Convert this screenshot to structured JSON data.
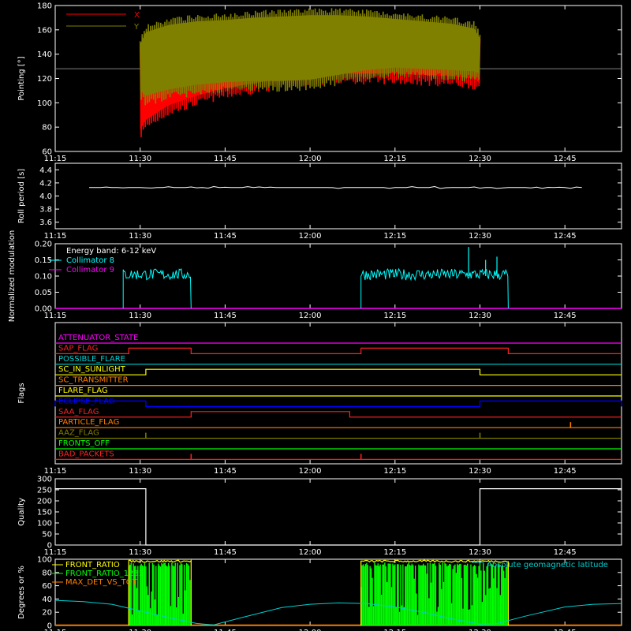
{
  "chart_data": [
    {
      "type": "area",
      "panel": "pointing",
      "ylabel": "Pointing [°]",
      "ylim": [
        60,
        180
      ],
      "yticks": [
        60,
        80,
        100,
        120,
        140,
        160,
        180
      ],
      "xlim": [
        "11:15",
        "12:55"
      ],
      "xticks": [
        "11:15",
        "11:30",
        "11:45",
        "12:00",
        "12:15",
        "12:30",
        "12:45"
      ],
      "reference_line": 128,
      "legend_position": "top-left",
      "series": [
        {
          "name": "X",
          "color": "#ff0000",
          "x": [
            "11:30",
            "11:31",
            "11:35",
            "11:40",
            "11:45",
            "11:50",
            "11:55",
            "12:00",
            "12:05",
            "12:10",
            "12:15",
            "12:20",
            "12:25",
            "12:29",
            "12:30"
          ],
          "upper": [
            148,
            150,
            154,
            157,
            159,
            160,
            161,
            161,
            160,
            160,
            158,
            157,
            156,
            153,
            152
          ],
          "lower": [
            72,
            80,
            92,
            100,
            106,
            110,
            114,
            117,
            118,
            118,
            118,
            117,
            116,
            114,
            110
          ]
        },
        {
          "name": "Y",
          "color": "#808000",
          "x": [
            "11:30",
            "11:31",
            "11:35",
            "11:40",
            "11:45",
            "11:50",
            "11:55",
            "12:00",
            "12:05",
            "12:10",
            "12:15",
            "12:20",
            "12:25",
            "12:29",
            "12:30"
          ],
          "upper": [
            152,
            162,
            168,
            171,
            172,
            174,
            175,
            176,
            176,
            175,
            173,
            171,
            169,
            165,
            157
          ],
          "lower": [
            104,
            100,
            105,
            109,
            111,
            112,
            112,
            113,
            117,
            121,
            123,
            122,
            121,
            120,
            118
          ]
        }
      ]
    },
    {
      "type": "line",
      "panel": "roll-period",
      "ylabel": "Roll period [s]",
      "ylim": [
        3.5,
        4.5
      ],
      "yticks": [
        3.6,
        3.8,
        4.0,
        4.2,
        4.4
      ],
      "xlim": [
        "11:15",
        "12:55"
      ],
      "xticks": [
        "11:15",
        "11:30",
        "11:45",
        "12:00",
        "12:15",
        "12:30",
        "12:45"
      ],
      "series": [
        {
          "name": "",
          "color": "#ffffff",
          "x": [
            "11:15",
            "12:55"
          ],
          "y": [
            4.13,
            4.13
          ]
        }
      ]
    },
    {
      "type": "line",
      "panel": "modulation",
      "ylabel": "Normalized modulation",
      "ylim": [
        0.0,
        0.2
      ],
      "yticks": [
        0.0,
        0.05,
        0.1,
        0.15,
        0.2
      ],
      "xlim": [
        "11:15",
        "12:55"
      ],
      "xticks": [
        "11:15",
        "11:30",
        "11:45",
        "12:00",
        "12:15",
        "12:30",
        "12:45"
      ],
      "annotation": "Energy band: 6-12 keV",
      "series": [
        {
          "name": "Collimator 8",
          "color": "#00ffff",
          "segments": [
            {
              "start": "11:27",
              "end": "11:39",
              "mean": 0.105
            },
            {
              "start": "12:09",
              "end": "12:35",
              "mean": 0.105
            }
          ],
          "peaks": [
            {
              "x": "12:28",
              "y": 0.19
            },
            {
              "x": "12:33",
              "y": 0.16
            },
            {
              "x": "12:31",
              "y": 0.15
            }
          ]
        },
        {
          "name": "Collimator 9",
          "color": "#ff00ff",
          "x": [
            "11:15",
            "12:55"
          ],
          "y": [
            0.0,
            0.0
          ]
        }
      ]
    },
    {
      "type": "line",
      "panel": "flags",
      "ylabel": "Flags",
      "xlim": [
        "11:15",
        "12:55"
      ],
      "xticks": [
        "11:15",
        "11:30",
        "11:45",
        "12:00",
        "12:15",
        "12:30",
        "12:45"
      ],
      "series": [
        {
          "name": "ATTENUATOR_STATE",
          "color": "#ff00ff",
          "steps": []
        },
        {
          "name": "SAP_FLAG",
          "color": "#ff2020",
          "steps": [
            [
              "11:28",
              "11:39"
            ],
            [
              "12:09",
              "12:35"
            ]
          ]
        },
        {
          "name": "POSSIBLE_FLARE",
          "color": "#00d0d0",
          "steps": []
        },
        {
          "name": "SC_IN_SUNLIGHT",
          "color": "#ffff00",
          "steps": [
            [
              "11:31",
              "12:30"
            ]
          ]
        },
        {
          "name": "SC_TRANSMITTER",
          "color": "#ff8000",
          "steps": []
        },
        {
          "name": "FLARE_FLAG",
          "color": "#ffff00",
          "steps": []
        },
        {
          "name": "ECLIPSE_FLAG",
          "color": "#0000ff",
          "steps": [
            [
              "11:15",
              "11:31"
            ],
            [
              "12:30",
              "12:55"
            ]
          ]
        },
        {
          "name": "SAA_FLAG",
          "color": "#ff2020",
          "steps": [
            [
              "11:39",
              "12:07"
            ]
          ]
        },
        {
          "name": "PARTICLE_FLAG",
          "color": "#ff8000",
          "spikes": [
            "12:46"
          ]
        },
        {
          "name": "AAZ_FLAG",
          "color": "#808000",
          "spikes": [
            "11:31",
            "12:30"
          ]
        },
        {
          "name": "FRONTS_OFF",
          "color": "#00ff00",
          "steps": []
        },
        {
          "name": "BAD_PACKETS",
          "color": "#ff2020",
          "spikes": [
            "11:39",
            "12:09"
          ]
        }
      ]
    },
    {
      "type": "line",
      "panel": "quality",
      "ylabel": "Quality",
      "ylim": [
        0,
        300
      ],
      "yticks": [
        0,
        50,
        100,
        150,
        200,
        250,
        300
      ],
      "xlim": [
        "11:15",
        "12:55"
      ],
      "xticks": [
        "11:15",
        "11:30",
        "11:45",
        "12:00",
        "12:15",
        "12:30",
        "12:45"
      ],
      "series": [
        {
          "name": "",
          "color": "#ffffff",
          "x": [
            "11:15",
            "11:31",
            "11:31",
            "12:30",
            "12:30",
            "12:55"
          ],
          "y": [
            255,
            255,
            0,
            0,
            255,
            255
          ]
        }
      ]
    },
    {
      "type": "line",
      "panel": "ratios",
      "ylabel": "Degrees or %",
      "ylim": [
        0,
        100
      ],
      "yticks": [
        0,
        20,
        40,
        60,
        80,
        100
      ],
      "xlim": [
        "11:15",
        "12:55"
      ],
      "xticks": [
        "11:15",
        "11:30",
        "11:45",
        "12:00",
        "12:15",
        "12:30",
        "12:45"
      ],
      "legend_position": "top-left",
      "series": [
        {
          "name": "FRONT_RATIO",
          "color": "#ffff00",
          "segments": [
            {
              "start": "11:28",
              "end": "11:39",
              "level": 97
            },
            {
              "start": "12:09",
              "end": "12:35",
              "level": 97
            }
          ]
        },
        {
          "name": "FRONT_RATIO_1235",
          "color": "#00ff00",
          "segments": [
            {
              "start": "11:28",
              "end": "11:39",
              "level": 95
            },
            {
              "start": "12:09",
              "end": "12:35",
              "level": 95
            }
          ]
        },
        {
          "name": "MAX_DET_VS_TOT",
          "color": "#ff8000",
          "x": [
            "11:15",
            "12:55"
          ],
          "y": [
            0,
            0
          ]
        },
        {
          "name": "Absolute geomagnetic latitude",
          "color": "#00d0d0",
          "x": [
            "11:15",
            "11:20",
            "11:25",
            "11:30",
            "11:35",
            "11:40",
            "11:43",
            "11:48",
            "11:55",
            "12:00",
            "12:05",
            "12:10",
            "12:15",
            "12:20",
            "12:25",
            "12:30",
            "12:33",
            "12:38",
            "12:45",
            "12:50",
            "12:55"
          ],
          "y": [
            38,
            36,
            32,
            22,
            12,
            3,
            1,
            12,
            27,
            32,
            34,
            33,
            28,
            20,
            10,
            2,
            3,
            14,
            28,
            32,
            33
          ]
        }
      ]
    }
  ],
  "colors": {
    "background": "#000000",
    "axes": "#ffffff",
    "reference_line": "#808080"
  }
}
